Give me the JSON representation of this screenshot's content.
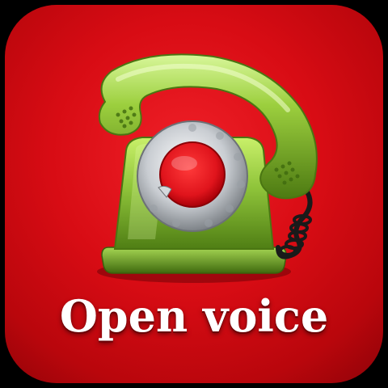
{
  "app": {
    "label": "Open voice",
    "icon": "rotary-telephone-icon"
  },
  "colors": {
    "background": "#d80c14",
    "phone_body": "#8fc43a",
    "dial_ring": "#c8ccd0",
    "dial_center": "#e0141c",
    "cord": "#1a1a1a",
    "label": "#ffffff"
  }
}
